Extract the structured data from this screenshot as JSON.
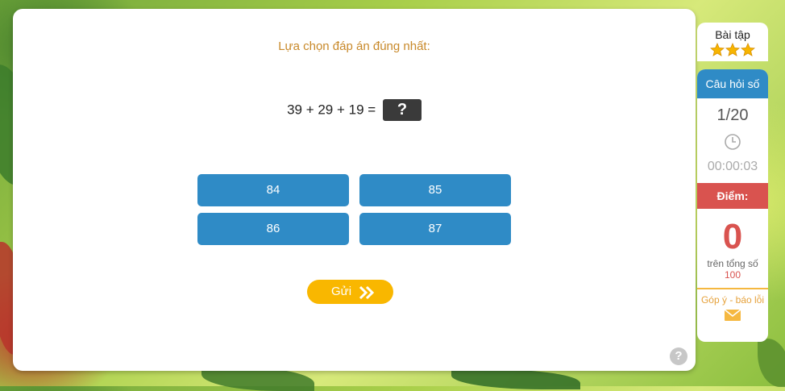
{
  "question": {
    "instruction": "Lựa chọn đáp án đúng nhất:",
    "expression": "39 + 29 + 19 =",
    "unknown": "?"
  },
  "answers": [
    "84",
    "85",
    "86",
    "87"
  ],
  "submit_label": "Gửi",
  "help_label": "?",
  "sidebar": {
    "exercise_title": "Bài tập",
    "stars": 3,
    "question_header": "Câu hỏi số",
    "progress": "1/20",
    "timer": "00:00:03",
    "score_header": "Điểm:",
    "score": "0",
    "total_label": "trên tổng số",
    "total": "100",
    "feedback_label": "Góp ý - báo lỗi"
  },
  "colors": {
    "answer_bg": "#2f8bc6",
    "submit_bg": "#f9b700",
    "score_red": "#d9534f",
    "instruction": "#c8892a"
  }
}
